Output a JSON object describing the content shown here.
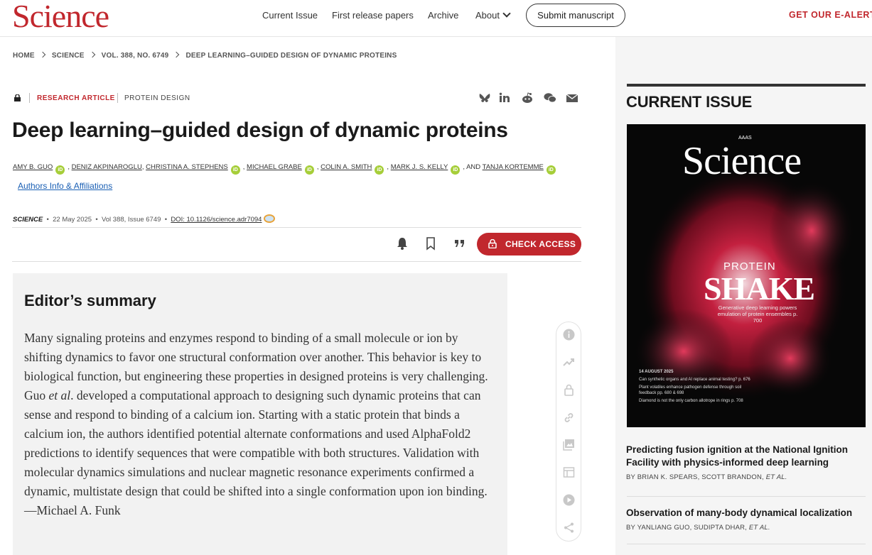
{
  "header": {
    "logo": "Science",
    "nav": [
      "Current Issue",
      "First release papers",
      "Archive",
      "About"
    ],
    "submit_label": "Submit manuscript",
    "ealerts_label": "GET OUR E-ALERTS"
  },
  "breadcrumb": [
    "HOME",
    "SCIENCE",
    "VOL. 388, NO. 6749",
    "DEEP LEARNING–GUIDED DESIGN OF DYNAMIC PROTEINS"
  ],
  "article": {
    "kicker": "RESEARCH ARTICLE",
    "topic": "PROTEIN DESIGN",
    "title": "Deep learning–guided design of dynamic proteins",
    "authors": [
      "AMY B. GUO",
      "DENIZ AKPINAROGLU",
      "CHRISTINA A. STEPHENS",
      "MICHAEL GRABE",
      "COLIN A. SMITH",
      "MARK J. S. KELLY",
      "TANJA KORTEMME"
    ],
    "authors_and": "AND",
    "affiliations_label": "Authors Info & Affiliations",
    "journal": "SCIENCE",
    "date": "22 May 2025",
    "volume": "Vol 388, Issue 6749",
    "doi": "DOI: 10.1126/science.adr7094",
    "access_label": "CHECK ACCESS"
  },
  "summary": {
    "heading": "Editor’s summary",
    "text_before": "Many signaling proteins and enzymes respond to binding of a small molecule or ion by shifting dynamics to favor one structural conformation over another. This behavior is key to biological function, but engineering these properties in designed proteins is very challenging. Guo ",
    "text_italic": "et al",
    "text_after": ". developed a computational approach to designing such dynamic proteins that can sense and respond to binding of a calcium ion. Starting with a static protein that binds a calcium ion, the authors identified potential alternate conformations and used AlphaFold2 predictions to identify sequences that were compatible with both structures. Validation with molecular dynamics simulations and nuclear magnetic resonance experiments confirmed a dynamic, multistate design that could be shifted into a single conformation upon ion binding. —Michael A. Funk"
  },
  "sidebar": {
    "current_issue": "CURRENT ISSUE",
    "cover": {
      "brand": "Science",
      "aaas": "AAAS",
      "protein": "PROTEIN",
      "shake": "SHAKE",
      "subtitle": "Generative deep learning powers emulation of protein ensembles",
      "subtitle_page": "p. 700",
      "date": "14 AUGUST 2025",
      "lines": [
        "Can synthetic organs and AI replace animal testing? p. 676",
        "Plant volatiles enhance pathogen defense through soil feedback pp. 680 & 698",
        "Diamond is not the only carbon allotrope in rings p. 708"
      ]
    },
    "related": [
      {
        "title": "Predicting fusion ignition at the National Ignition Facility with physics-informed deep learning",
        "by": "BY BRIAN K. SPEARS,  SCOTT BRANDON,",
        "etal": "ET AL."
      },
      {
        "title": "Observation of many-body dynamical localization",
        "by": "BY YANLIANG GUO,  SUDIPTA DHAR,",
        "etal": "ET AL."
      }
    ]
  },
  "colors": {
    "brand_red": "#c1272d",
    "orcid_green": "#a6ce39",
    "link_blue": "#1a5fb4"
  }
}
